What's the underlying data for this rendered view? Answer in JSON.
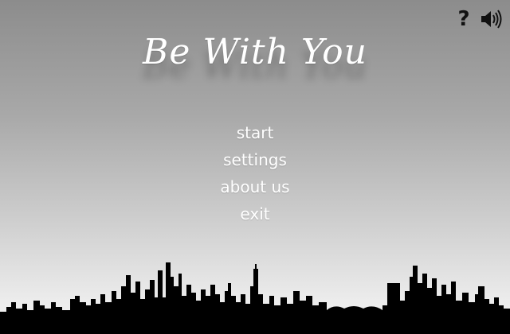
{
  "title": "Be With You",
  "menu": {
    "items": [
      {
        "id": "start",
        "label": "start"
      },
      {
        "id": "settings",
        "label": "settings"
      },
      {
        "id": "about",
        "label": "about us"
      },
      {
        "id": "exit",
        "label": "exit"
      }
    ]
  },
  "controls": {
    "help_label": "?",
    "help_icon": "question-icon",
    "sound_icon": "speaker-icon"
  },
  "colors": {
    "text": "#ffffff",
    "silhouette": "#000000",
    "icon": "#111111"
  }
}
